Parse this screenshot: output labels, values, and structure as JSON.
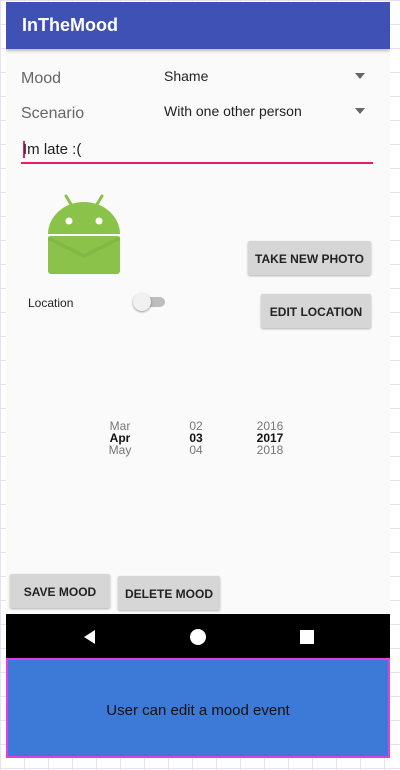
{
  "app": {
    "title": "InTheMood"
  },
  "form": {
    "mood_label": "Mood",
    "mood_value": "Shame",
    "scenario_label": "Scenario",
    "scenario_value": "With one other person",
    "reason_value": "Im late :("
  },
  "photo": {
    "icon": "android-icon",
    "take_photo_label": "TAKE NEW PHOTO"
  },
  "location": {
    "label": "Location",
    "toggle_on": false,
    "edit_label": "EDIT LOCATION"
  },
  "date_picker": {
    "months": [
      "Mar",
      "Apr",
      "May"
    ],
    "days": [
      "02",
      "03",
      "04"
    ],
    "years": [
      "2016",
      "2017",
      "2018"
    ],
    "selected_index": 1
  },
  "actions": {
    "save_label": "SAVE MOOD",
    "delete_label": "DELETE MOOD"
  },
  "navbar": {
    "back_icon": "back-triangle-icon",
    "home_icon": "home-circle-icon",
    "recents_icon": "recents-square-icon"
  },
  "caption": {
    "text": "User can edit a mood event"
  },
  "colors": {
    "primary": "#3f51b5",
    "accent": "#e91e63",
    "android_green": "#8bc34a",
    "caption_bg": "#3d79d6",
    "caption_border": "#e040e0"
  }
}
